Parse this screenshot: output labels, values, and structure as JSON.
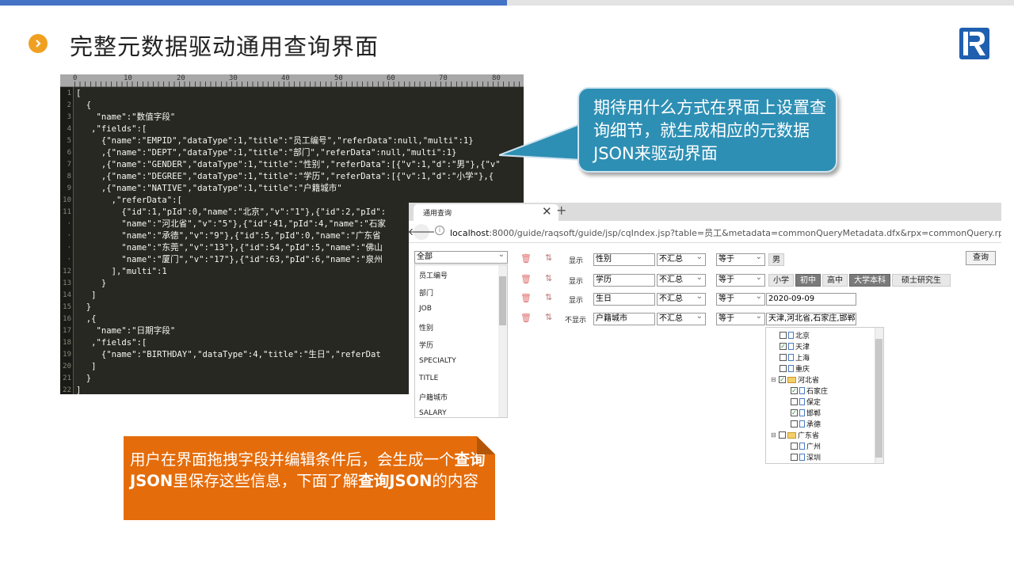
{
  "slide": {
    "title": "完整元数据驱动通用查询界面"
  },
  "editor": {
    "ruler_marks": [
      "0",
      "10",
      "20",
      "30",
      "40",
      "50",
      "60",
      "70",
      "80"
    ],
    "line_numbers": [
      "1",
      "2",
      "3",
      "4",
      "5",
      "6",
      "7",
      "8",
      "9",
      "10",
      "11",
      "·",
      "·",
      "·",
      "·",
      "12",
      "13",
      "14",
      "15",
      "16",
      "17",
      "18",
      "19",
      "20",
      "21",
      "22"
    ],
    "lines": [
      "[",
      "  {",
      "    \"name\":\"数值字段\"",
      "   ,\"fields\":[",
      "     {\"name\":\"EMPID\",\"dataType\":1,\"title\":\"员工编号\",\"referData\":null,\"multi\":1}",
      "     ,{\"name\":\"DEPT\",\"dataType\":1,\"title\":\"部门\",\"referData\":null,\"multi\":1}",
      "     ,{\"name\":\"GENDER\",\"dataType\":1,\"title\":\"性别\",\"referData\":[{\"v\":1,\"d\":\"男\"},{\"v\"",
      "     ,{\"name\":\"DEGREE\",\"dataType\":1,\"title\":\"学历\",\"referData\":[{\"v\":1,\"d\":\"小学\"},{",
      "     ,{\"name\":\"NATIVE\",\"dataType\":1,\"title\":\"户籍城市\"",
      "       ,\"referData\":[",
      "         {\"id\":1,\"pId\":0,\"name\":\"北京\",\"v\":\"1\"},{\"id\":2,\"pId\":",
      "         \"name\":\"河北省\",\"v\":\"5\"},{\"id\":41,\"pId\":4,\"name\":\"石家",
      "         \"name\":\"承德\",\"v\":\"9\"},{\"id\":5,\"pId\":0,\"name\":\"广东省",
      "         \"name\":\"东莞\",\"v\":\"13\"},{\"id\":54,\"pId\":5,\"name\":\"佛山",
      "         \"name\":\"厦门\",\"v\":\"17\"},{\"id\":63,\"pId\":6,\"name\":\"泉州",
      "       ],\"multi\":1",
      "     }",
      "   ]",
      "  }",
      "  ,{",
      "    \"name\":\"日期字段\"",
      "   ,\"fields\":[",
      "     {\"name\":\"BIRTHDAY\",\"dataType\":4,\"title\":\"生日\",\"referDat",
      "   ]",
      "  }",
      "]"
    ]
  },
  "callout_blue": {
    "text": "期待用什么方式在界面上设置查询细节，就生成相应的元数据JSON来驱动界面"
  },
  "browser": {
    "tab_title": "通用查询",
    "tab_close": "✕",
    "new_tab": "+",
    "url_host": "localhost",
    "url_rest": ":8000/guide/raqsoft/guide/jsp/cqIndex.jsp?table=员工&metadata=commonQueryMetadata.dfx&rpx=commonQuery.rpx",
    "query_button": "查询",
    "field_select": "全部",
    "field_list": [
      "员工编号",
      "部门",
      "JOB",
      "性别",
      "学历",
      "SPECIALTY",
      "TITLE",
      "户籍城市",
      "SALARY"
    ],
    "conditions": [
      {
        "visibility": "显示",
        "field": "性别",
        "agg": "不汇总",
        "op": "等于",
        "value_chips": [
          "男"
        ],
        "on": [
          false
        ]
      },
      {
        "visibility": "显示",
        "field": "学历",
        "agg": "不汇总",
        "op": "等于",
        "value_chips": [
          "小学",
          "初中",
          "高中",
          "大学本科",
          "硕士研究生"
        ],
        "on": [
          false,
          true,
          false,
          true,
          false
        ]
      },
      {
        "visibility": "显示",
        "field": "生日",
        "agg": "不汇总",
        "op": "等于",
        "value_text": "2020-09-09"
      },
      {
        "visibility": "不显示",
        "field": "户籍城市",
        "agg": "不汇总",
        "op": "等于",
        "value_text": "天津,河北省,石家庄,邯郸"
      }
    ],
    "tree": [
      {
        "label": "北京",
        "checked": false,
        "level": 1,
        "folder": false
      },
      {
        "label": "天津",
        "checked": true,
        "level": 1,
        "folder": false
      },
      {
        "label": "上海",
        "checked": false,
        "level": 1,
        "folder": false
      },
      {
        "label": "重庆",
        "checked": false,
        "level": 1,
        "folder": false
      },
      {
        "label": "河北省",
        "checked": true,
        "level": 0,
        "folder": true
      },
      {
        "label": "石家庄",
        "checked": true,
        "level": 2,
        "folder": false
      },
      {
        "label": "保定",
        "checked": false,
        "level": 2,
        "folder": false
      },
      {
        "label": "邯郸",
        "checked": true,
        "level": 2,
        "folder": false
      },
      {
        "label": "承德",
        "checked": false,
        "level": 2,
        "folder": false
      },
      {
        "label": "广东省",
        "checked": false,
        "level": 0,
        "folder": true
      },
      {
        "label": "广州",
        "checked": false,
        "level": 2,
        "folder": false
      },
      {
        "label": "深圳",
        "checked": false,
        "level": 2,
        "folder": false
      }
    ]
  },
  "callout_orange": {
    "part1": "用户在界面拖拽字段并编辑条件后，会生成一个",
    "bold1": "查询JSON",
    "part2": "里保存这些信息，下面了解",
    "bold2": "查询JSON",
    "part3": "的内容"
  },
  "colors": {
    "accent_blue": "#4472c4",
    "bullet_orange": "#f0a020",
    "callout_blue": "#2e8fb4",
    "callout_orange": "#e56c0a",
    "editor_bg": "#272822"
  }
}
